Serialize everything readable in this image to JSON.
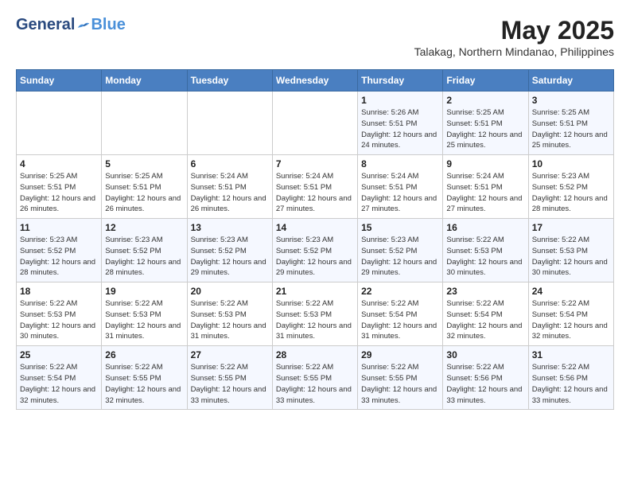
{
  "header": {
    "logo_general": "General",
    "logo_blue": "Blue",
    "month_year": "May 2025",
    "location": "Talakag, Northern Mindanao, Philippines"
  },
  "weekdays": [
    "Sunday",
    "Monday",
    "Tuesday",
    "Wednesday",
    "Thursday",
    "Friday",
    "Saturday"
  ],
  "weeks": [
    [
      null,
      null,
      null,
      null,
      {
        "day": "1",
        "sunrise": "5:26 AM",
        "sunset": "5:51 PM",
        "daylight": "12 hours and 24 minutes."
      },
      {
        "day": "2",
        "sunrise": "5:25 AM",
        "sunset": "5:51 PM",
        "daylight": "12 hours and 25 minutes."
      },
      {
        "day": "3",
        "sunrise": "5:25 AM",
        "sunset": "5:51 PM",
        "daylight": "12 hours and 25 minutes."
      }
    ],
    [
      {
        "day": "4",
        "sunrise": "5:25 AM",
        "sunset": "5:51 PM",
        "daylight": "12 hours and 26 minutes."
      },
      {
        "day": "5",
        "sunrise": "5:25 AM",
        "sunset": "5:51 PM",
        "daylight": "12 hours and 26 minutes."
      },
      {
        "day": "6",
        "sunrise": "5:24 AM",
        "sunset": "5:51 PM",
        "daylight": "12 hours and 26 minutes."
      },
      {
        "day": "7",
        "sunrise": "5:24 AM",
        "sunset": "5:51 PM",
        "daylight": "12 hours and 27 minutes."
      },
      {
        "day": "8",
        "sunrise": "5:24 AM",
        "sunset": "5:51 PM",
        "daylight": "12 hours and 27 minutes."
      },
      {
        "day": "9",
        "sunrise": "5:24 AM",
        "sunset": "5:51 PM",
        "daylight": "12 hours and 27 minutes."
      },
      {
        "day": "10",
        "sunrise": "5:23 AM",
        "sunset": "5:52 PM",
        "daylight": "12 hours and 28 minutes."
      }
    ],
    [
      {
        "day": "11",
        "sunrise": "5:23 AM",
        "sunset": "5:52 PM",
        "daylight": "12 hours and 28 minutes."
      },
      {
        "day": "12",
        "sunrise": "5:23 AM",
        "sunset": "5:52 PM",
        "daylight": "12 hours and 28 minutes."
      },
      {
        "day": "13",
        "sunrise": "5:23 AM",
        "sunset": "5:52 PM",
        "daylight": "12 hours and 29 minutes."
      },
      {
        "day": "14",
        "sunrise": "5:23 AM",
        "sunset": "5:52 PM",
        "daylight": "12 hours and 29 minutes."
      },
      {
        "day": "15",
        "sunrise": "5:23 AM",
        "sunset": "5:52 PM",
        "daylight": "12 hours and 29 minutes."
      },
      {
        "day": "16",
        "sunrise": "5:22 AM",
        "sunset": "5:53 PM",
        "daylight": "12 hours and 30 minutes."
      },
      {
        "day": "17",
        "sunrise": "5:22 AM",
        "sunset": "5:53 PM",
        "daylight": "12 hours and 30 minutes."
      }
    ],
    [
      {
        "day": "18",
        "sunrise": "5:22 AM",
        "sunset": "5:53 PM",
        "daylight": "12 hours and 30 minutes."
      },
      {
        "day": "19",
        "sunrise": "5:22 AM",
        "sunset": "5:53 PM",
        "daylight": "12 hours and 31 minutes."
      },
      {
        "day": "20",
        "sunrise": "5:22 AM",
        "sunset": "5:53 PM",
        "daylight": "12 hours and 31 minutes."
      },
      {
        "day": "21",
        "sunrise": "5:22 AM",
        "sunset": "5:53 PM",
        "daylight": "12 hours and 31 minutes."
      },
      {
        "day": "22",
        "sunrise": "5:22 AM",
        "sunset": "5:54 PM",
        "daylight": "12 hours and 31 minutes."
      },
      {
        "day": "23",
        "sunrise": "5:22 AM",
        "sunset": "5:54 PM",
        "daylight": "12 hours and 32 minutes."
      },
      {
        "day": "24",
        "sunrise": "5:22 AM",
        "sunset": "5:54 PM",
        "daylight": "12 hours and 32 minutes."
      }
    ],
    [
      {
        "day": "25",
        "sunrise": "5:22 AM",
        "sunset": "5:54 PM",
        "daylight": "12 hours and 32 minutes."
      },
      {
        "day": "26",
        "sunrise": "5:22 AM",
        "sunset": "5:55 PM",
        "daylight": "12 hours and 32 minutes."
      },
      {
        "day": "27",
        "sunrise": "5:22 AM",
        "sunset": "5:55 PM",
        "daylight": "12 hours and 33 minutes."
      },
      {
        "day": "28",
        "sunrise": "5:22 AM",
        "sunset": "5:55 PM",
        "daylight": "12 hours and 33 minutes."
      },
      {
        "day": "29",
        "sunrise": "5:22 AM",
        "sunset": "5:55 PM",
        "daylight": "12 hours and 33 minutes."
      },
      {
        "day": "30",
        "sunrise": "5:22 AM",
        "sunset": "5:56 PM",
        "daylight": "12 hours and 33 minutes."
      },
      {
        "day": "31",
        "sunrise": "5:22 AM",
        "sunset": "5:56 PM",
        "daylight": "12 hours and 33 minutes."
      }
    ]
  ],
  "labels": {
    "sunrise_prefix": "Sunrise: ",
    "sunset_prefix": "Sunset: ",
    "daylight_prefix": "Daylight: "
  }
}
